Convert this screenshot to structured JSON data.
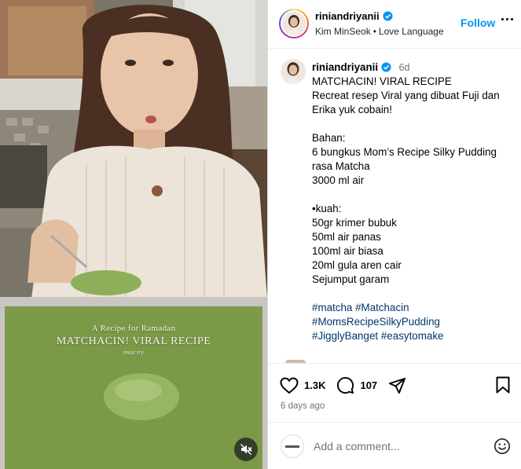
{
  "video": {
    "overlay_subtitle": "A Recipe for Ramadan",
    "overlay_title": "MATCHACIN! VIRAL RECIPE",
    "overlay_small": "must try",
    "mute_icon": "speaker-muted-icon"
  },
  "header": {
    "username": "riniandriyanii",
    "music_artist": "Kim MinSeok",
    "music_separator": "•",
    "music_title": "Love Language",
    "follow_label": "Follow"
  },
  "caption": {
    "username": "riniandriyanii",
    "time": "6d",
    "lines": [
      "MATCHACIN! VIRAL RECIPE",
      "Recreat resep Viral yang dibuat Fuji dan",
      "Erika yuk cobain!",
      "",
      "Bahan:",
      "6 bungkus Mom’s Recipe Silky Pudding",
      "rasa Matcha",
      "3000 ml air",
      "",
      "•kuah:",
      "50gr krimer bubuk",
      "50ml air panas",
      "100ml air biasa",
      "20ml gula aren cair",
      "Sejumput garam"
    ],
    "hashtags": [
      [
        "#matcha",
        "#Matchacin"
      ],
      [
        "#MomsRecipeSilkyPudding"
      ],
      [
        "#JigglyBanget",
        "#easytomake"
      ]
    ]
  },
  "actions": {
    "likes": "1.3K",
    "comments": "107",
    "posted": "6 days ago"
  },
  "comment_box": {
    "placeholder": "Add a comment..."
  },
  "colors": {
    "accent": "#0095f6",
    "hashtag": "#00376b",
    "muted": "#737373",
    "matcha": "#7a9a48"
  }
}
